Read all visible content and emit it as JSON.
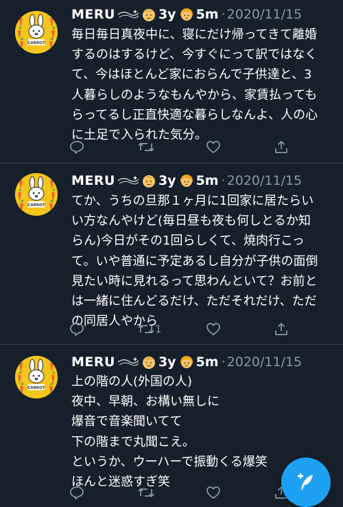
{
  "tweets": [
    {
      "name": "MERU",
      "age_child1": "3y",
      "age_child2": "5m",
      "date": "2020/11/15",
      "lines": [
        "毎日毎日真夜中に、寝にだけ帰ってきて離婚",
        "するのはするけど、今すぐにって訳ではなく",
        "て、今はほとんど家におらんで子供達と、3",
        "人暮らしのようなもんやから、家賃払っても",
        "らってるし正直快適な暮らしなんよ、人の心",
        "に土足で入られた気分。"
      ],
      "reply_count": "",
      "retweet_count": "",
      "like_count": ""
    },
    {
      "name": "MERU",
      "age_child1": "3y",
      "age_child2": "5m",
      "date": "2020/11/15",
      "lines": [
        "てか、うちの旦那１ヶ月に1回家に居たらい",
        "い方なんやけど(毎日昼も夜も何しとるか知",
        "らん)今日がその1回らしくて、焼肉行こっ",
        "て。いや普通に予定あるし自分が子供の面倒",
        "見たい時に見れるって思わんといて？お前と",
        "は一緒に住んどるだけ、ただそれだけ、ただ",
        "の同居人やから"
      ],
      "reply_count": "",
      "retweet_count": "1",
      "like_count": ""
    },
    {
      "name": "MERU",
      "age_child1": "3y",
      "age_child2": "5m",
      "date": "2020/11/15",
      "lines": [
        "上の階の人(外国の人)",
        "夜中、早朝、お構い無しに",
        "爆音で音楽聞いてて",
        "下の階まで丸聞こえ。",
        "というか、ウーハーで振動くる爆笑",
        "ほんと迷惑すぎ笑"
      ],
      "reply_count": "",
      "retweet_count": "",
      "like_count": ""
    }
  ],
  "icons": {
    "avatar": "miffy-carrot-avatar",
    "reply": "reply-icon",
    "retweet": "retweet-icon",
    "like": "like-icon",
    "share": "share-icon",
    "compose": "compose-tweet-icon"
  },
  "colors": {
    "background": "#15202b",
    "divider": "#38444d",
    "secondary_text": "#8899a6",
    "accent": "#1da1f2",
    "avatar_bg": "#f4c51c"
  }
}
